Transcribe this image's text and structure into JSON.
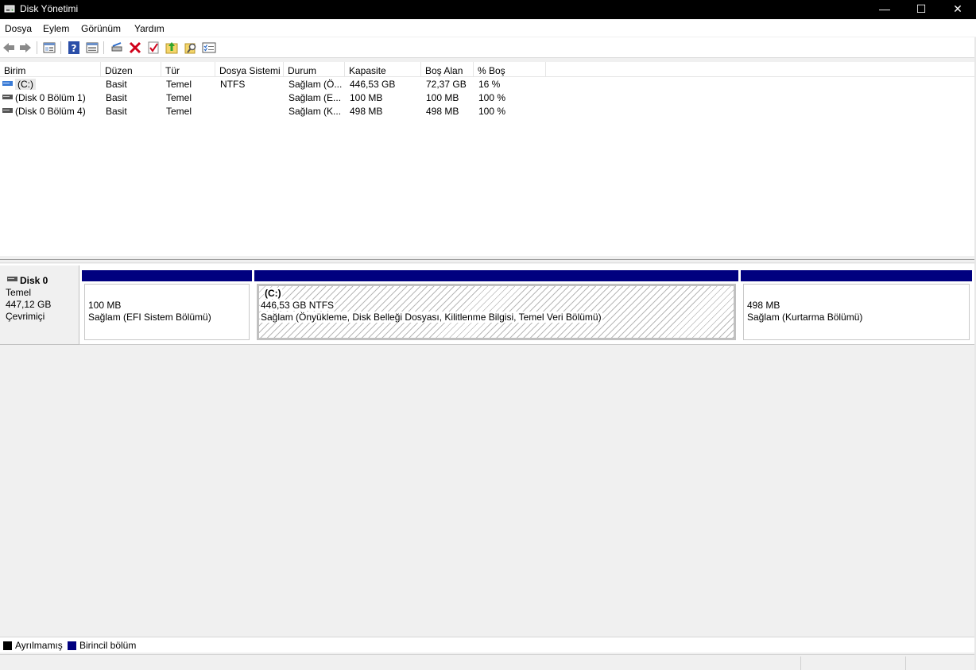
{
  "window": {
    "title": "Disk Yönetimi",
    "minimize_glyph": "—",
    "maximize_glyph": "☐",
    "close_glyph": "✕"
  },
  "menu": [
    "Dosya",
    "Eylem",
    "Görünüm",
    "Yardım"
  ],
  "toolbar": {
    "icons": [
      "back-icon",
      "forward-icon",
      "console-tree-icon",
      "help-icon",
      "properties-icon",
      "connect-icon",
      "delete-icon",
      "check-icon",
      "import-icon",
      "search-icon",
      "checklist-icon"
    ]
  },
  "volume_list": {
    "columns": [
      "Birim",
      "Düzen",
      "Tür",
      "Dosya Sistemi",
      "Durum",
      "Kapasite",
      "Boş Alan",
      "% Boş"
    ],
    "rows": [
      {
        "name": "(C:)",
        "layout": "Basit",
        "type": "Temel",
        "fs": "NTFS",
        "status": "Sağlam (Ö...",
        "capacity": "446,53 GB",
        "free": "72,37 GB",
        "pct_free": "16 %"
      },
      {
        "name": "(Disk 0 Bölüm 1)",
        "layout": "Basit",
        "type": "Temel",
        "fs": "",
        "status": "Sağlam (E...",
        "capacity": "100 MB",
        "free": "100 MB",
        "pct_free": "100 %"
      },
      {
        "name": "(Disk 0 Bölüm 4)",
        "layout": "Basit",
        "type": "Temel",
        "fs": "",
        "status": "Sağlam (K...",
        "capacity": "498 MB",
        "free": "498 MB",
        "pct_free": "100 %"
      }
    ]
  },
  "disk": {
    "name": "Disk 0",
    "type": "Temel",
    "size": "447,12 GB",
    "state": "Çevrimiçi",
    "partitions": [
      {
        "title": "",
        "size": "100 MB",
        "status": "Sağlam (EFI Sistem Bölümü)"
      },
      {
        "title": "(C:)",
        "size": "446,53 GB NTFS",
        "status": "Sağlam (Önyükleme, Disk Belleği Dosyası, Kilitlenme Bilgisi, Temel Veri Bölümü)"
      },
      {
        "title": "",
        "size": "498 MB",
        "status": "Sağlam (Kurtarma Bölümü)"
      }
    ]
  },
  "legend": {
    "unallocated": "Ayrılmamış",
    "primary": "Birincil bölüm",
    "unallocated_color": "#000000",
    "primary_color": "#00007f"
  }
}
